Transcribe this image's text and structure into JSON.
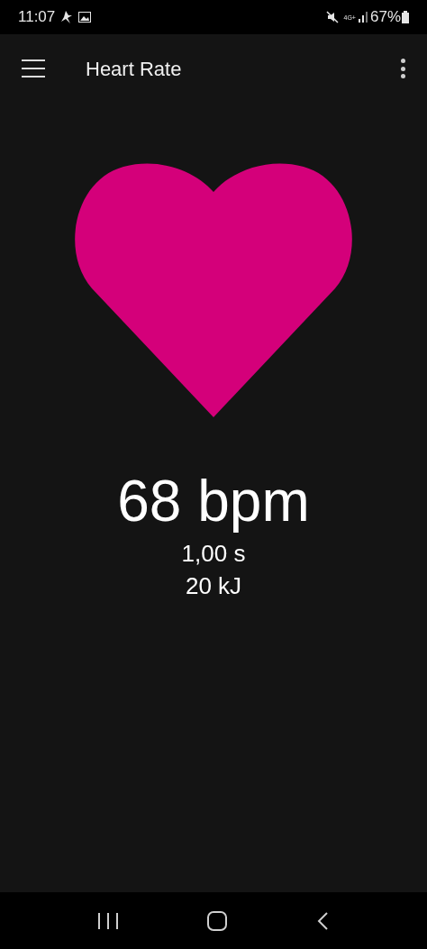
{
  "status_bar": {
    "time": "11:07",
    "battery": "67%",
    "network": "4G+"
  },
  "app_bar": {
    "title": "Heart Rate"
  },
  "reading": {
    "rate": "68 bpm",
    "interval": "1,00 s",
    "energy": "20 kJ"
  }
}
